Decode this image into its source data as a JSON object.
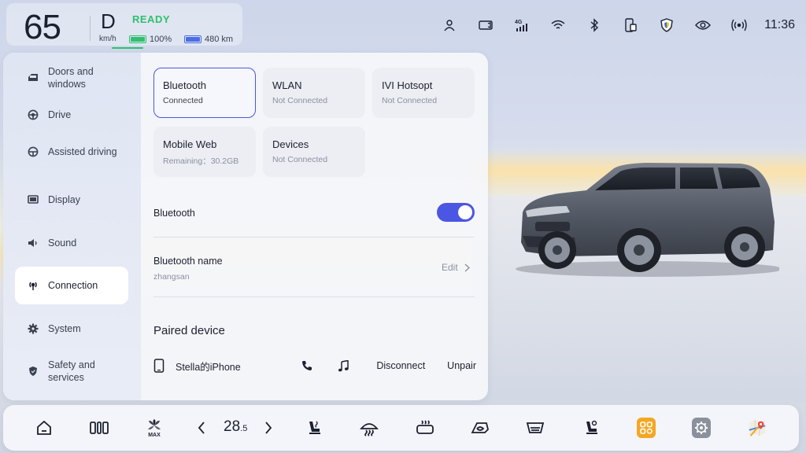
{
  "status": {
    "speed": "65",
    "speed_unit": "km/h",
    "gear": "D",
    "ready": "READY",
    "battery_percent": "100%",
    "range": "480 km",
    "time": "11:36",
    "network": "4G",
    "icons": [
      "user-icon",
      "dashcam-icon",
      "signal-4g-icon",
      "wifi-icon",
      "bluetooth-icon",
      "phone-projection-icon",
      "shield-icon",
      "eye-icon",
      "hotspot-icon"
    ],
    "colors": {
      "ready": "#2fbf6e",
      "battery": "#2fbf6e",
      "range": "#4b6ee2"
    }
  },
  "sidebar": {
    "items": [
      {
        "label": "Doors and windows",
        "icon": "car-door-icon"
      },
      {
        "label": "Drive",
        "icon": "steering-wheel-icon"
      },
      {
        "label": "Assisted driving",
        "icon": "assist-steering-icon"
      },
      {
        "label": "Display",
        "icon": "display-icon"
      },
      {
        "label": "Sound",
        "icon": "speaker-icon"
      },
      {
        "label": "Connection",
        "icon": "connection-icon",
        "active": true
      },
      {
        "label": "System",
        "icon": "gear-icon"
      },
      {
        "label": "Safety and services",
        "icon": "shield-icon"
      }
    ]
  },
  "tiles": [
    {
      "title": "Bluetooth",
      "sub": "Connected",
      "selected": true
    },
    {
      "title": "WLAN",
      "sub": "Not Connected"
    },
    {
      "title": "IVI Hotsopt",
      "sub": "Not Connected"
    },
    {
      "title": "Mobile Web",
      "sub": "Remaining：30.2GB"
    },
    {
      "title": "Devices",
      "sub": "Not Connected"
    }
  ],
  "bluetooth": {
    "toggle_label": "Bluetooth",
    "enabled": true,
    "name_label": "Bluetooth name",
    "name_value": "zhangsan",
    "edit_label": "Edit",
    "paired_title": "Paired device",
    "device_name": "Stella的iPhone",
    "disconnect_label": "Disconnect",
    "unpair_label": "Unpair"
  },
  "dock": {
    "temperature_main": "28",
    "temperature_decimal": ".5",
    "icons": [
      "home-icon",
      "split-view-icon",
      "fan-max-icon",
      "temp-down-icon",
      "temp-up-icon",
      "seat-heat-icon",
      "front-defrost-icon",
      "rear-defrost-icon",
      "air-recirculation-icon",
      "windshield-icon",
      "seat-ventilation-icon",
      "apps-icon",
      "settings-app-icon",
      "maps-icon"
    ],
    "accent": "#f5a623"
  }
}
